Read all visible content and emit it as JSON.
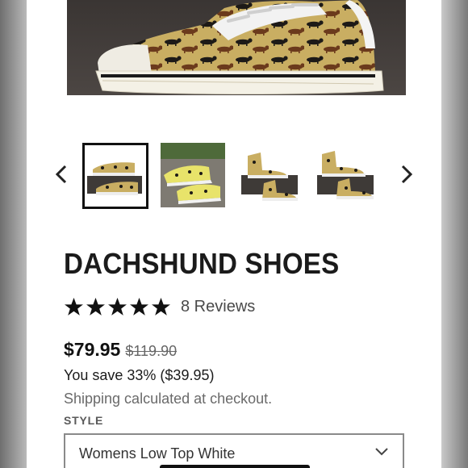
{
  "product": {
    "title": "DACHSHUND SHOES",
    "rating_stars": 5,
    "reviews_label": "8 Reviews",
    "price": "$79.95",
    "compare_price": "$119.90",
    "savings": "You save 33% ($39.95)",
    "shipping_text": "Shipping calculated at checkout.",
    "style_label": "STYLE",
    "style_selected": "Womens Low Top White"
  },
  "gallery": {
    "thumbnails": [
      {
        "name": "low-top-boxed",
        "selected": true
      },
      {
        "name": "worn-outdoors",
        "selected": false
      },
      {
        "name": "high-top-boxed-front",
        "selected": false
      },
      {
        "name": "high-top-boxed-dark",
        "selected": false
      }
    ]
  },
  "colors": {
    "shoe_print": "#c9ae62",
    "dog_dark": "#1d1a17",
    "dog_brown": "#6b3a1c",
    "text": "#1b1b1b",
    "muted": "#6a6a6a",
    "star": "#111111"
  },
  "icons": [
    "chevron-left-icon",
    "chevron-right-icon",
    "star-icon",
    "chevron-down-icon"
  ]
}
